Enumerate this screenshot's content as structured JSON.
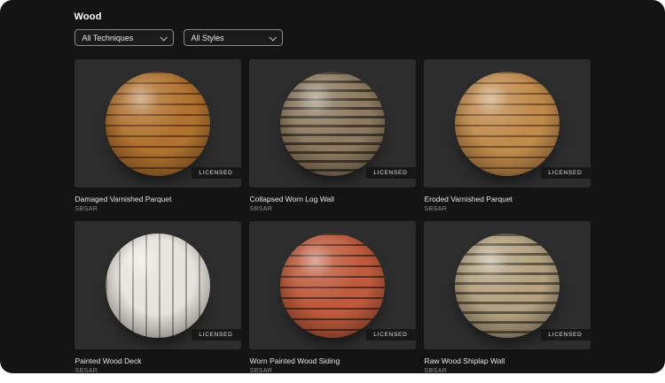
{
  "page": {
    "title": "Wood"
  },
  "filters": [
    {
      "label": "All Techniques",
      "icon": "chevron-down-icon"
    },
    {
      "label": "All Styles",
      "icon": "chevron-down-icon"
    }
  ],
  "cards": [
    {
      "title": "Damaged Varnished Parquet",
      "format": "SBSAR",
      "badge": "LICENSED",
      "sphere": {
        "base": "#b0722f",
        "line": "#6d3f18",
        "direction": "180deg"
      }
    },
    {
      "title": "Collapsed Worn Log Wall",
      "format": "SBSAR",
      "badge": "LICENSED",
      "sphere": {
        "base": "#8d7b61",
        "line": "#43392b",
        "direction": "180deg"
      }
    },
    {
      "title": "Eroded Varnished Parquet",
      "format": "SBSAR",
      "badge": "LICENSED",
      "sphere": {
        "base": "#c08a4c",
        "line": "#7a5226",
        "direction": "180deg"
      }
    },
    {
      "title": "Painted Wood Deck",
      "format": "SBSAR",
      "badge": "LICENSED",
      "sphere": {
        "base": "#e6e3dc",
        "line": "#9d9b94",
        "direction": "90deg"
      }
    },
    {
      "title": "Worn Painted Wood Siding",
      "format": "SBSAR",
      "badge": "LICENSED",
      "sphere": {
        "base": "#bf5a3c",
        "line": "#5f2a1a",
        "direction": "180deg"
      }
    },
    {
      "title": "Raw Wood Shiplap Wall",
      "format": "SBSAR",
      "badge": "LICENSED",
      "sphere": {
        "base": "#b4a281",
        "line": "#5e5440",
        "direction": "180deg"
      }
    }
  ],
  "colors": {
    "panel_bg": "#141414",
    "tile_bg": "#2d2d2d",
    "dropdown_bg": "#1b1b1b",
    "dropdown_border": "#8a8a8a"
  }
}
